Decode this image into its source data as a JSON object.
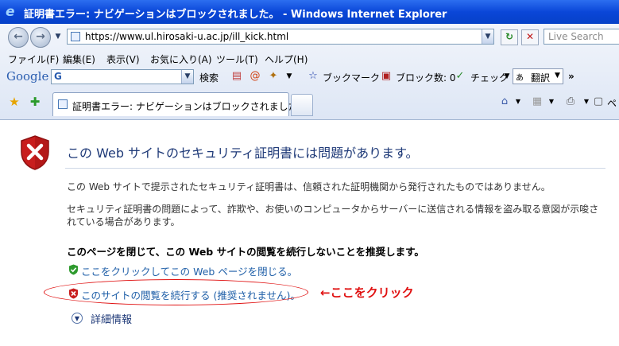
{
  "window": {
    "title": "証明書エラー: ナビゲーションはブロックされました。 - Windows Internet Explorer"
  },
  "address_bar": {
    "url": "https://www.ul.hirosaki-u.ac.jp/ill_kick.html"
  },
  "search": {
    "placeholder": "Live Search"
  },
  "menu": {
    "file": "ファイル(F)",
    "edit": "編集(E)",
    "view": "表示(V)",
    "favorites": "お気に入り(A)",
    "tools": "ツール(T)",
    "help": "ヘルプ(H)"
  },
  "google_toolbar": {
    "logo": "Google",
    "search_label": "検索",
    "bookmarks": "ブックマーク",
    "blocked": "ブロック数: 0",
    "check": "チェック",
    "translate": "翻訳",
    "more": "»"
  },
  "tab": {
    "title": "証明書エラー: ナビゲーションはブロックされました。"
  },
  "page_toolbar": {
    "page_label": "ペ"
  },
  "page": {
    "heading": "この Web サイトのセキュリティ証明書には問題があります。",
    "para1": "この Web サイトで提示されたセキュリティ証明書は、信頼された証明機関から発行されたものではありません。",
    "para2": "セキュリティ証明書の問題によって、詐欺や、お使いのコンピュータからサーバーに送信される情報を盗み取る意図が示唆されている場合があります。",
    "recommendation": "このページを閉じて、この Web サイトの閲覧を続行しないことを推奨します。",
    "close_link": "ここをクリックしてこの Web ページを閉じる。",
    "continue_link": "このサイトの閲覧を続行する (推奨されません)。",
    "more_info": "詳細情報"
  },
  "annotation": {
    "text": "←ここをクリック"
  },
  "colors": {
    "accent": "#1f3a78",
    "link": "#1f5fa8",
    "annotation": "#e01010"
  }
}
